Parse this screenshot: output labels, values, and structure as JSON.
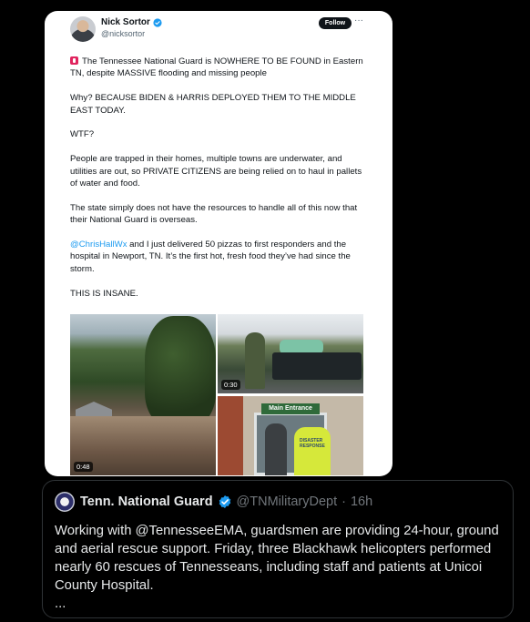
{
  "tweet": {
    "author_name": "Nick Sortor",
    "author_handle": "@nicksortor",
    "follow_label": "Follow",
    "more_label": "···",
    "paragraphs": {
      "p1": "The Tennessee National Guard is NOWHERE TO BE FOUND in Eastern TN, despite MASSIVE flooding and missing people",
      "p2": "Why? BECAUSE BIDEN & HARRIS DEPLOYED THEM TO THE MIDDLE EAST TODAY.",
      "p3": "WTF?",
      "p4": "People are trapped in their homes, multiple towns are underwater, and utilities are out, so PRIVATE CITIZENS are being relied on to haul in pallets of water and food.",
      "p5": "The state simply does not have the resources to handle all of this now that their National Guard is overseas.",
      "p6_mention": "@ChrisHallWx",
      "p6_rest": " and I just delivered 50 pizzas to first responders and the hospital in Newport, TN. It’s the first hot, fresh food they’ve had since the storm.",
      "p7": "THIS IS INSANE."
    },
    "media": {
      "video1_duration": "0:48",
      "video2_duration": "0:30",
      "entrance_sign": "Main Entrance",
      "vest_text": "DISASTER RESPONSE"
    },
    "icons": {
      "alarm": "police-light-icon",
      "verified": "verified-badge-icon"
    }
  },
  "quote": {
    "author_name": "Tenn. National Guard",
    "author_handle": "@TNMilitaryDept",
    "separator": "·",
    "time": "16h",
    "text": "Working with @TennesseeEMA, guardsmen are providing 24-hour, ground and aerial rescue support. Friday, three Blackhawk helicopters performed nearly 60 rescues of Tennesseans, including staff and patients at Unicoi County Hospital.",
    "ellipsis": "..."
  },
  "colors": {
    "background": "#000000",
    "card": "#ffffff",
    "link": "#1d9bf0",
    "verified": "#1d9bf0",
    "alarm": "#e0245e"
  }
}
